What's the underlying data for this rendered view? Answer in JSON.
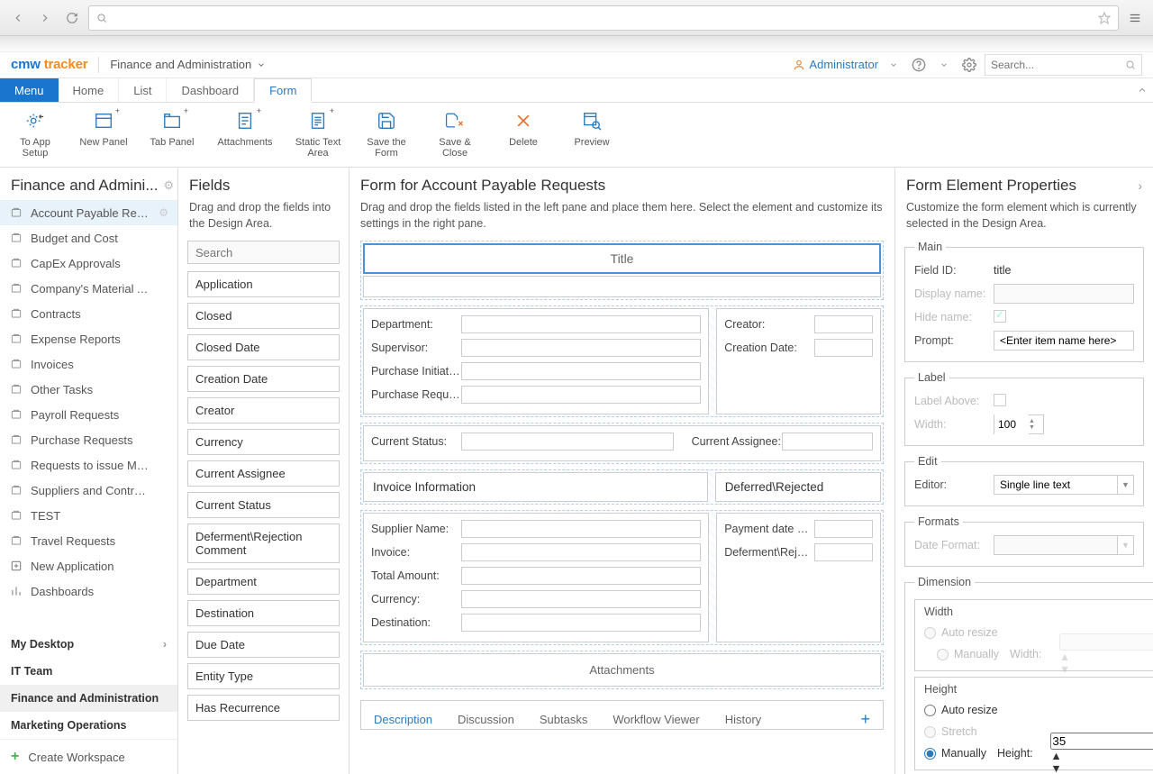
{
  "browser": {
    "title": ""
  },
  "app": {
    "logo1": "cmw",
    "logo2": "tracker",
    "workspace": "Finance and Administration",
    "user": "Administrator",
    "search_placeholder": "Search..."
  },
  "mainTabs": {
    "menu": "Menu",
    "home": "Home",
    "list": "List",
    "dashboard": "Dashboard",
    "form": "Form"
  },
  "ribbon": {
    "toAppSetup": "To App Setup",
    "newPanel": "New Panel",
    "tabPanel": "Tab Panel",
    "attachments": "Attachments",
    "staticText": "Static Text Area",
    "saveForm": "Save the Form",
    "saveClose": "Save & Close",
    "delete": "Delete",
    "preview": "Preview"
  },
  "leftNav": {
    "title": "Finance and Admini...",
    "items": [
      "Account Payable Requ...",
      "Budget and Cost",
      "CapEx Approvals",
      "Company's Material A...",
      "Contracts",
      "Expense Reports",
      "Invoices",
      "Other Tasks",
      "Payroll Requests",
      "Purchase Requests",
      "Requests to issue Mat...",
      "Suppliers and Contrac...",
      "TEST",
      "Travel Requests",
      "New Application",
      "Dashboards"
    ],
    "sections": [
      "My Desktop",
      "IT Team",
      "Finance and Administration",
      "Marketing Operations"
    ],
    "createWorkspace": "Create Workspace"
  },
  "fieldsPanel": {
    "title": "Fields",
    "sub": "Drag and drop the fields into the Design Area.",
    "search_placeholder": "Search",
    "items": [
      "Application",
      "Closed",
      "Closed Date",
      "Creation Date",
      "Creator",
      "Currency",
      "Current Assignee",
      "Current Status",
      "Deferment\\Rejection Comment",
      "Department",
      "Destination",
      "Due Date",
      "Entity Type",
      "Has Recurrence"
    ]
  },
  "design": {
    "title": "Form for Account Payable Requests",
    "sub": "Drag and drop the fields listed in the left pane and place them here. Select the element and customize its settings in the right pane.",
    "titleRow": "Title",
    "col1": [
      "Department:",
      "Supervisor:",
      "Purchase Initiator:",
      "Purchase Request:"
    ],
    "col2": [
      "Creator:",
      "Creation Date:"
    ],
    "statusRow": {
      "left": "Current Status:",
      "right": "Current Assignee:"
    },
    "sectionHeads": {
      "left": "Invoice Information",
      "right": "Deferred\\Rejected"
    },
    "invCol": [
      "Supplier Name:",
      "Invoice:",
      "Total Amount:",
      "Currency:",
      "Destination:"
    ],
    "defCol": [
      "Payment date po...",
      "Deferment\\Rejec..."
    ],
    "attachments": "Attachments",
    "bottomTabs": [
      "Description",
      "Discussion",
      "Subtasks",
      "Workflow Viewer",
      "History"
    ]
  },
  "props": {
    "title": "Form Element Properties",
    "sub": "Customize the form element which is currently selected in the Design Area.",
    "main": {
      "legend": "Main",
      "fieldIdLabel": "Field ID:",
      "fieldId": "title",
      "displayNameLabel": "Display name:",
      "hideNameLabel": "Hide name:",
      "promptLabel": "Prompt:",
      "prompt": "<Enter item name here>"
    },
    "label": {
      "legend": "Label",
      "aboveLabel": "Label Above:",
      "widthLabel": "Width:",
      "width": "100"
    },
    "edit": {
      "legend": "Edit",
      "editorLabel": "Editor:",
      "editor": "Single line text"
    },
    "formats": {
      "legend": "Formats",
      "dateLabel": "Date Format:"
    },
    "dimension": {
      "legend": "Dimension",
      "widthTitle": "Width",
      "autoResize": "Auto resize",
      "manually": "Manually",
      "widthLabel": "Width:",
      "heightTitle": "Height",
      "stretch": "Stretch",
      "heightLabel": "Height:",
      "height": "35"
    }
  }
}
